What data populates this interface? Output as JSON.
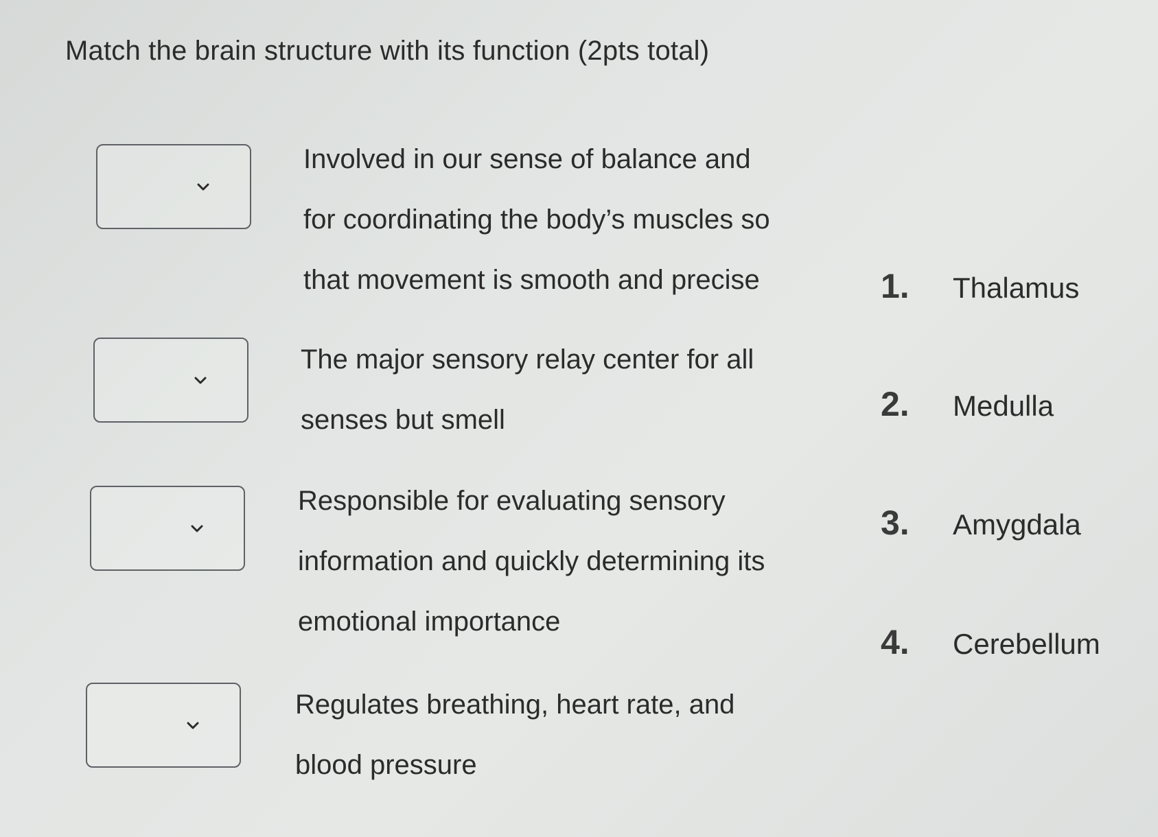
{
  "title": "Match the brain structure with its function (2pts total)",
  "questions": [
    {
      "lines": [
        "Involved in our sense of balance and",
        "for coordinating the body’s muscles so",
        "that movement is smooth and precise"
      ]
    },
    {
      "lines": [
        "The major sensory relay center for all",
        "senses but smell"
      ]
    },
    {
      "lines": [
        "Responsible for evaluating sensory",
        "information and quickly determining its",
        "emotional importance"
      ]
    },
    {
      "lines": [
        "Regulates breathing, heart rate, and",
        "blood pressure"
      ]
    }
  ],
  "options": [
    {
      "num": "1.",
      "label": "Thalamus"
    },
    {
      "num": "2.",
      "label": "Medulla"
    },
    {
      "num": "3.",
      "label": "Amygdala"
    },
    {
      "num": "4.",
      "label": "Cerebellum"
    }
  ],
  "icons": {
    "dropdown": "chevron-down-icon"
  }
}
